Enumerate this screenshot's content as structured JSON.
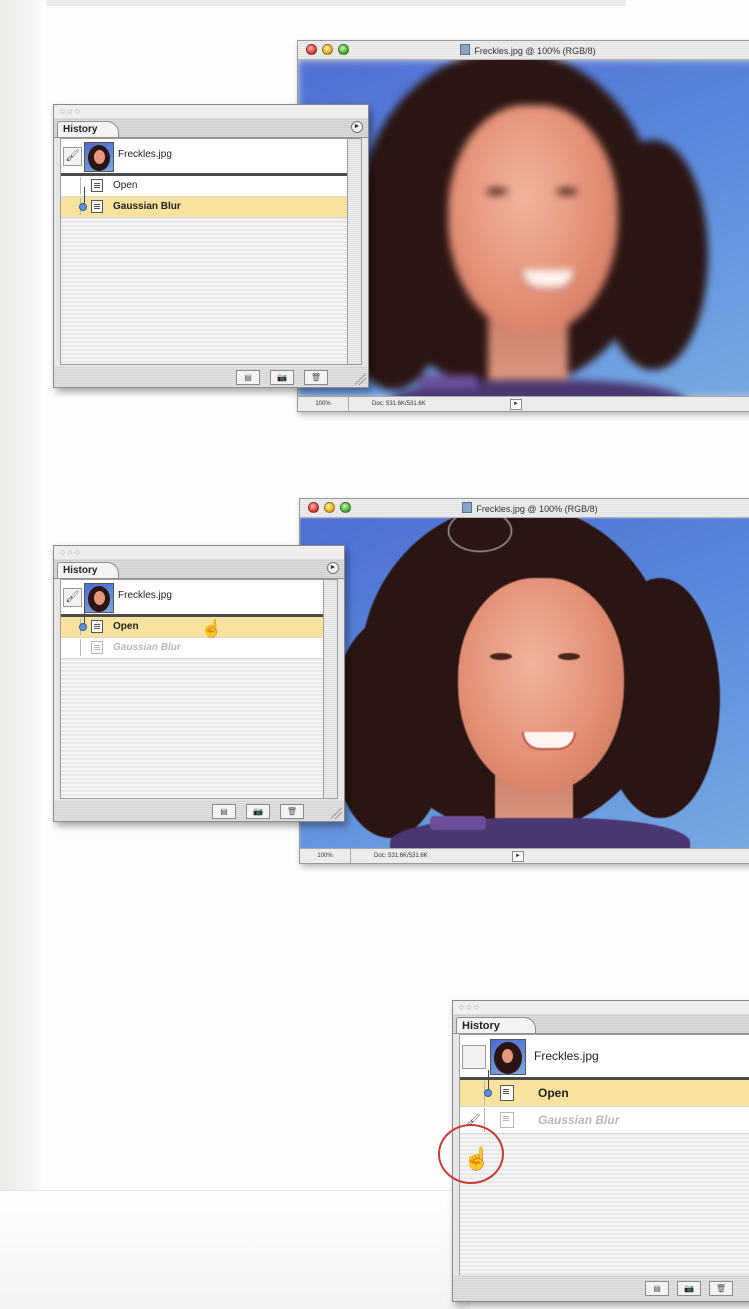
{
  "document_window": {
    "title": "Freckles.jpg @ 100% (RGB/8)",
    "zoom": "100%",
    "doc_size": "Doc: 531.6K/531.6K"
  },
  "history_panel": {
    "tab_label": "History",
    "snapshot_name": "Freckles.jpg",
    "steps": [
      "Open",
      "Gaussian Blur"
    ]
  },
  "icons": {
    "palette_menu": "►",
    "status_arrow": "►",
    "brush": "🖌",
    "pointer": "☝",
    "new_document": "▤",
    "snapshot": "📷",
    "trash": "🗑"
  },
  "colors": {
    "selected_row": "#f7e39e",
    "callout": "#c83a3a"
  }
}
